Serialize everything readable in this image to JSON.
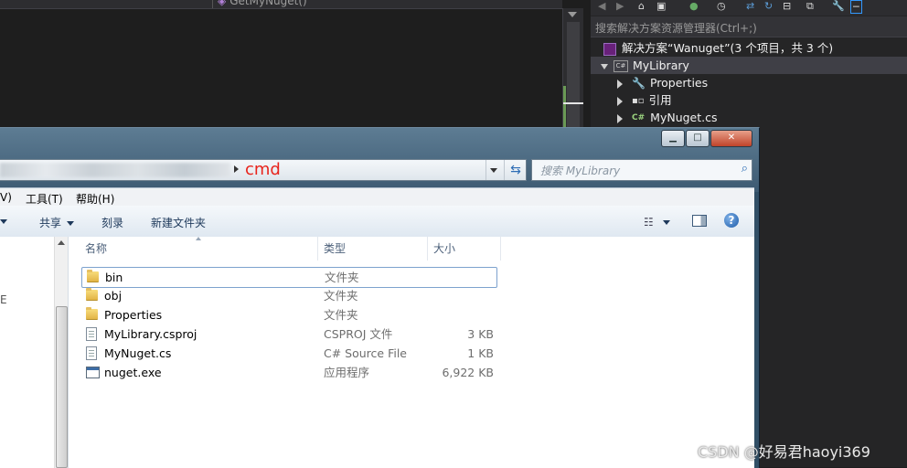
{
  "vs": {
    "member_dropdown": "GetMyNuget()"
  },
  "solution_explorer": {
    "search_placeholder": "搜索解决方案资源管理器(Ctrl+;)",
    "solution_label": "解决方案“Wanuget”(3 个项目，共 3 个)",
    "project": "MyLibrary",
    "items": [
      "Properties",
      "引用",
      "MyNuget.cs"
    ]
  },
  "explorer": {
    "address_current": "cmd",
    "search_placeholder": "搜索 MyLibrary",
    "menu": [
      "V)",
      "工具(T)",
      "帮助(H)"
    ],
    "commands": [
      "共享",
      "刻录",
      "新建文件夹"
    ],
    "columns": {
      "name": "名称",
      "type": "类型",
      "size": "大小"
    },
    "files": [
      {
        "name": "bin",
        "type": "文件夹",
        "size": "",
        "icon": "folder-icon"
      },
      {
        "name": "obj",
        "type": "文件夹",
        "size": "",
        "icon": "folder-icon"
      },
      {
        "name": "Properties",
        "type": "文件夹",
        "size": "",
        "icon": "folder-icon"
      },
      {
        "name": "MyLibrary.csproj",
        "type": "CSPROJ 文件",
        "size": "3 KB",
        "icon": "file-icon"
      },
      {
        "name": "MyNuget.cs",
        "type": "C# Source File",
        "size": "1 KB",
        "icon": "file-icon"
      },
      {
        "name": "nuget.exe",
        "type": "应用程序",
        "size": "6,922 KB",
        "icon": "exe-icon"
      }
    ],
    "nav_fragment": "E"
  },
  "watermark": "CSDN @好易君haoyi369"
}
